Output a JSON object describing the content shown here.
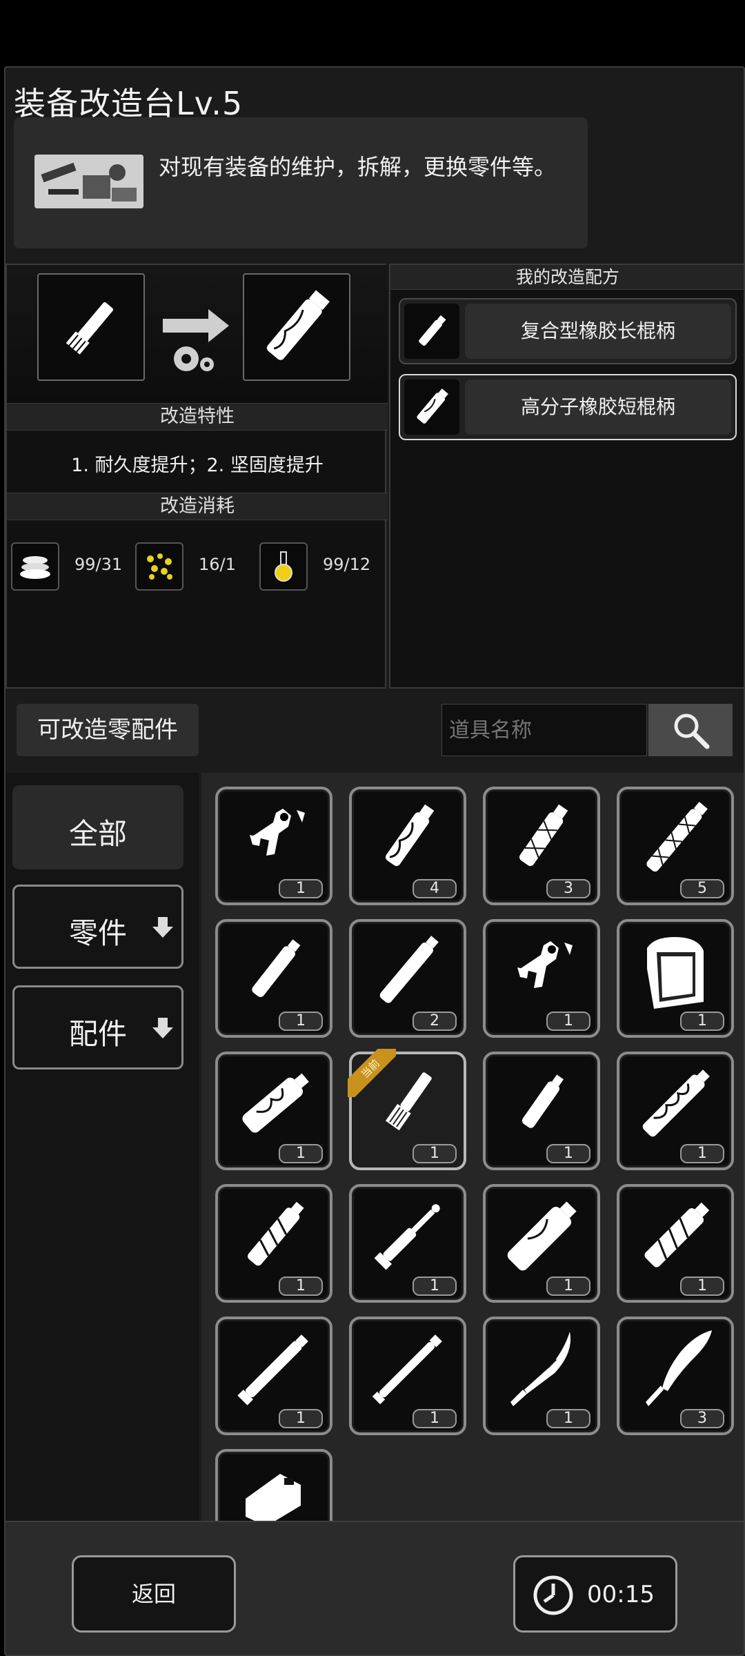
{
  "header": {
    "title": "装备改造台Lv.5",
    "description": "对现有装备的维护，拆解，更换零件等。"
  },
  "modify": {
    "features_title": "改造特性",
    "features": "1. 耐久度提升；2. 坚固度提升",
    "cost_title": "改造消耗",
    "costs": [
      {
        "icon": "material-stack-icon",
        "value": "99/31"
      },
      {
        "icon": "gold-nuggets-icon",
        "value": "16/1"
      },
      {
        "icon": "flask-icon",
        "value": "99/12"
      }
    ]
  },
  "recipes": {
    "title": "我的改造配方",
    "items": [
      {
        "label": "复合型橡胶长棍柄",
        "selected": false
      },
      {
        "label": "高分子橡胶短棍柄",
        "selected": true
      }
    ]
  },
  "parts": {
    "title": "可改造零配件",
    "search_placeholder": "道具名称",
    "current_badge": "当前"
  },
  "sidebar": {
    "items": [
      {
        "label": "全部",
        "active": true
      },
      {
        "label": "零件",
        "active": false
      },
      {
        "label": "配件",
        "active": false
      }
    ]
  },
  "grid": [
    {
      "icon": "trigger-part-icon",
      "count": "1"
    },
    {
      "icon": "wrapped-grip-icon",
      "count": "4"
    },
    {
      "icon": "woven-grip-icon",
      "count": "3"
    },
    {
      "icon": "long-woven-grip-icon",
      "count": "5"
    },
    {
      "icon": "plain-grip-icon",
      "count": "1"
    },
    {
      "icon": "long-grip-icon",
      "count": "2"
    },
    {
      "icon": "trigger-part-icon",
      "count": "1"
    },
    {
      "icon": "pouch-icon",
      "count": "1"
    },
    {
      "icon": "swirl-grip-icon",
      "count": "1"
    },
    {
      "icon": "short-grip-icon",
      "count": "1",
      "current": true
    },
    {
      "icon": "small-grip-icon",
      "count": "1"
    },
    {
      "icon": "swirl-long-grip-icon",
      "count": "1"
    },
    {
      "icon": "taped-grip-icon",
      "count": "1"
    },
    {
      "icon": "rod-icon",
      "count": "1"
    },
    {
      "icon": "thick-grip-icon",
      "count": "1"
    },
    {
      "icon": "taped-grip-icon",
      "count": "1"
    },
    {
      "icon": "staff-icon",
      "count": "1"
    },
    {
      "icon": "staff-icon",
      "count": "1"
    },
    {
      "icon": "machete-blade-icon",
      "count": "1"
    },
    {
      "icon": "curved-blade-icon",
      "count": "3"
    },
    {
      "icon": "device-icon",
      "count": ""
    }
  ],
  "footer": {
    "back_label": "返回",
    "timer": "00:15"
  }
}
